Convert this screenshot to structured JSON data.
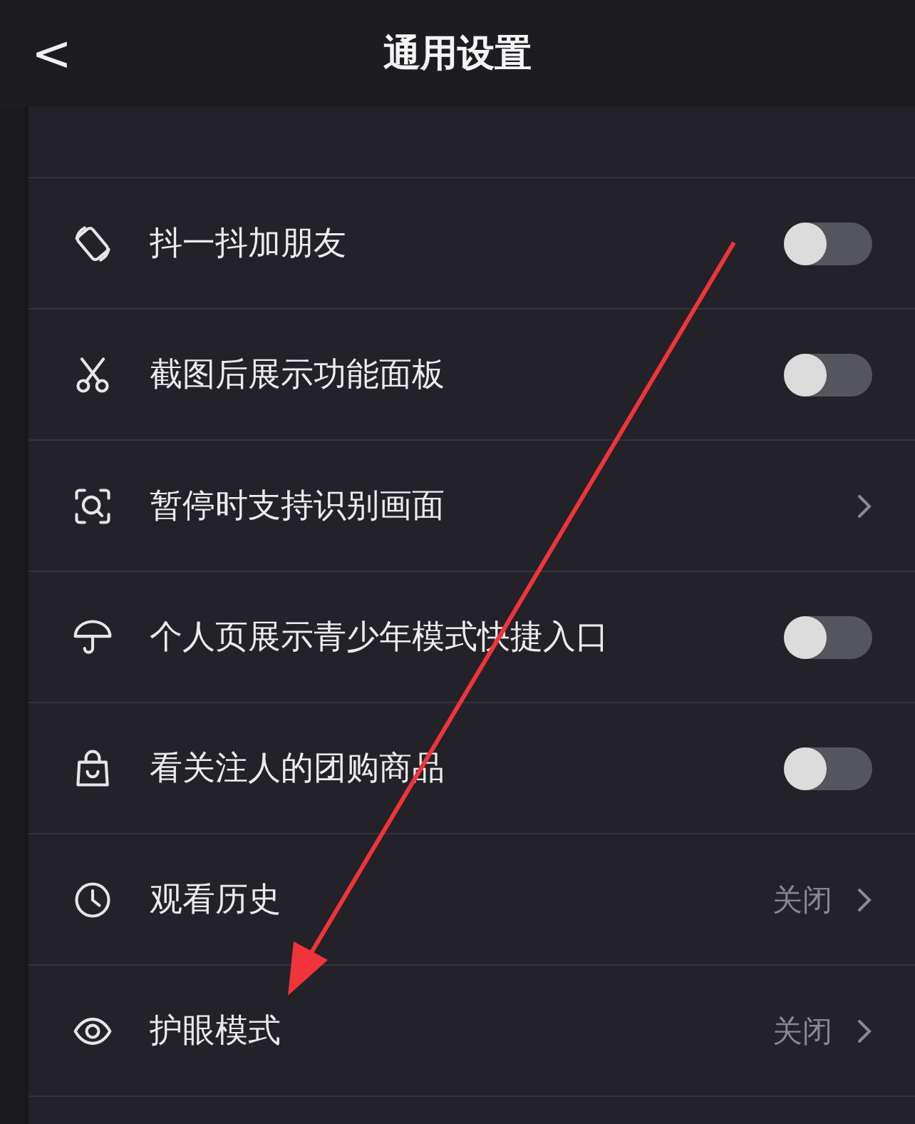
{
  "header": {
    "back": "<",
    "title": "通用设置"
  },
  "rows": [
    {
      "kind": "toggle",
      "label": "抖一抖加朋友",
      "on": false
    },
    {
      "kind": "toggle",
      "label": "截图后展示功能面板",
      "on": false
    },
    {
      "kind": "link",
      "label": "暂停时支持识别画面"
    },
    {
      "kind": "toggle",
      "label": "个人页展示青少年模式快捷入口",
      "on": false
    },
    {
      "kind": "toggle",
      "label": "看关注人的团购商品",
      "on": false
    },
    {
      "kind": "link",
      "label": "观看历史",
      "value": "关闭"
    },
    {
      "kind": "link",
      "label": "护眼模式",
      "value": "关闭"
    }
  ]
}
